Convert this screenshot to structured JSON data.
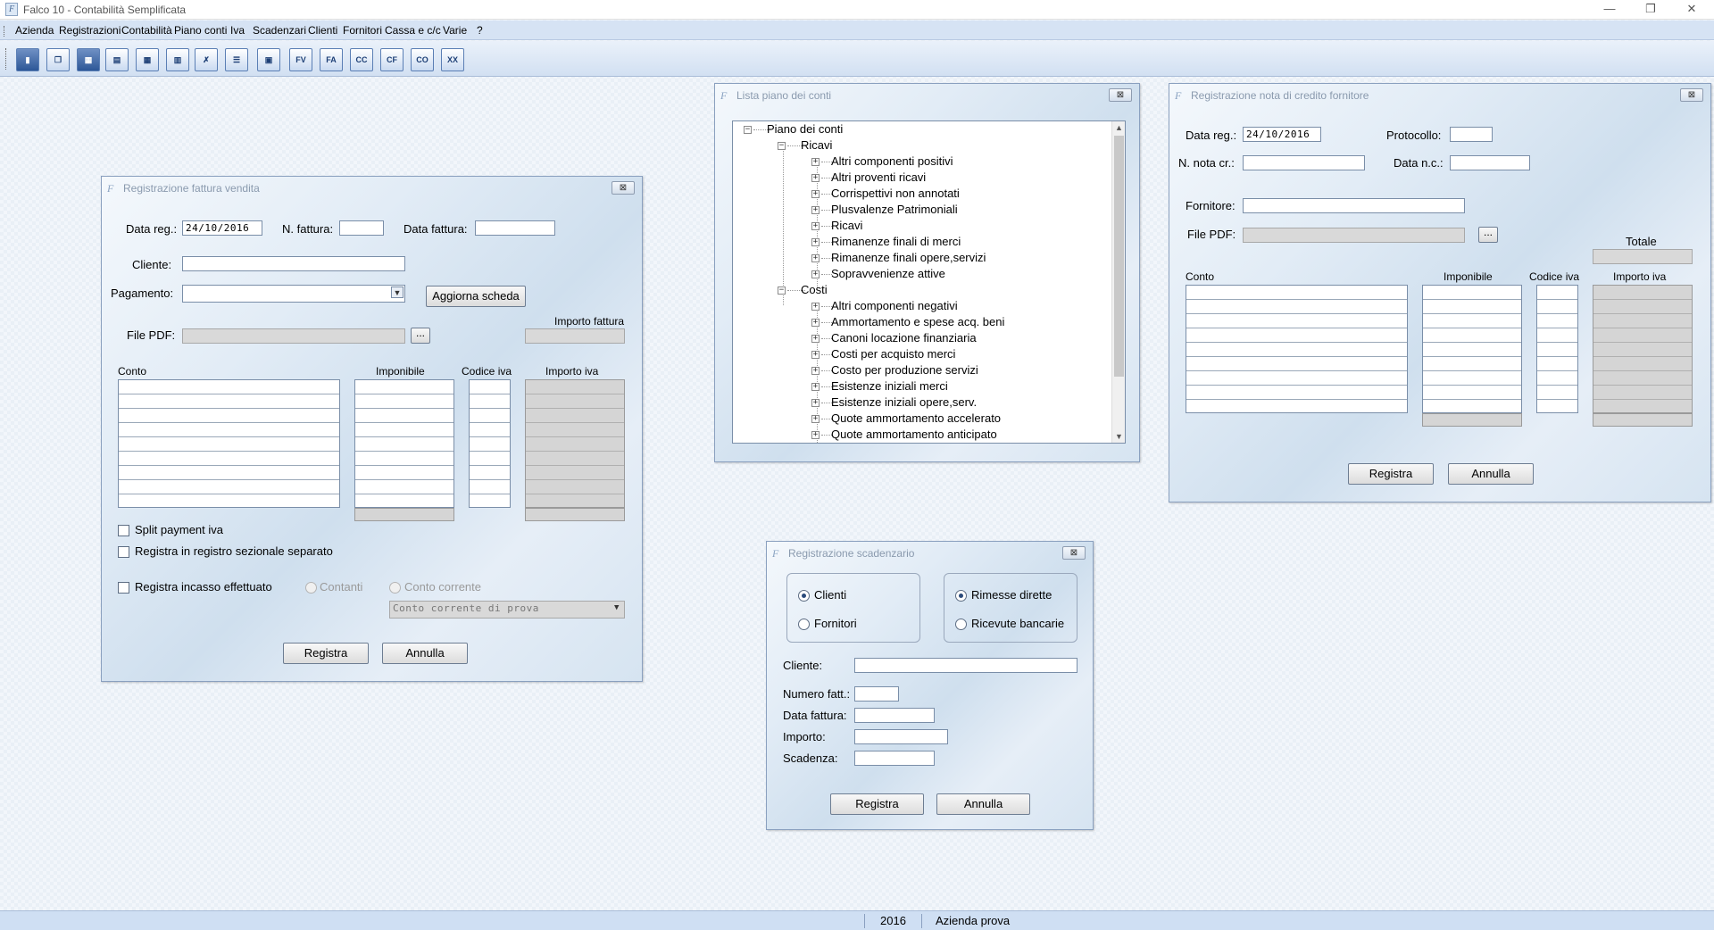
{
  "app": {
    "title": "Falco 10 - Contabilità Semplificata",
    "icon": "F"
  },
  "window_controls": {
    "minimize": "—",
    "restore": "❐",
    "close": "✕"
  },
  "menu": [
    "Azienda",
    "Registrazioni",
    "Contabilità",
    "Piano conti",
    "Iva",
    "Scadenzari",
    "Clienti",
    "Fornitori",
    "Cassa e c/c",
    "Varie",
    "?"
  ],
  "toolbar": {
    "fv": "FV",
    "fa": "FA",
    "cc": "CC",
    "cf": "CF",
    "co": "CO",
    "xx": "XX"
  },
  "fattura": {
    "title": "Registrazione fattura vendita",
    "close": "⊠",
    "data_reg_label": "Data reg.:",
    "data_reg": "24/10/2016",
    "n_fattura_label": "N. fattura:",
    "n_fattura": "",
    "data_fattura_label": "Data fattura:",
    "data_fattura": "",
    "cliente_label": "Cliente:",
    "cliente": "",
    "pagamento_label": "Pagamento:",
    "pagamento": "",
    "aggiorna_label": "Aggiorna scheda",
    "file_pdf_label": "File PDF:",
    "file_pdf": "",
    "browse_label": "...",
    "importo_fattura_label": "Importo fattura",
    "importo_fattura": "",
    "col_conto": "Conto",
    "col_imponibile": "Imponibile",
    "col_codice_iva": "Codice iva",
    "col_importo_iva": "Importo iva",
    "split_label": "Split payment iva",
    "registro_label": "Registra in registro sezionale separato",
    "incasso_label": "Registra incasso effettuato",
    "contanti_label": "Contanti",
    "conto_corrente_label": "Conto corrente",
    "conto_corrente_value": "Conto corrente di prova",
    "registra_label": "Registra",
    "annulla_label": "Annulla"
  },
  "piano": {
    "title": "Lista piano dei conti",
    "close": "⊠",
    "root": "Piano dei conti",
    "ricavi": "Ricavi",
    "ricavi_items": [
      "Altri componenti positivi",
      "Altri proventi ricavi",
      "Corrispettivi non annotati",
      "Plusvalenze Patrimoniali",
      "Ricavi",
      "Rimanenze finali di merci",
      "Rimanenze finali opere,servizi",
      "Sopravvenienze attive"
    ],
    "costi": "Costi",
    "costi_items": [
      "Altri componenti negativi",
      "Ammortamento e spese acq. beni",
      "Canoni locazione finanziaria",
      "Costi per acquisto merci",
      "Costo per produzione servizi",
      "Esistenze iniziali merci",
      "Esistenze iniziali opere,serv.",
      "Quote ammortamento accelerato",
      "Quote ammortamento anticipato"
    ],
    "expand": "+",
    "collapse": "−"
  },
  "nota": {
    "title": "Registrazione nota di credito fornitore",
    "close": "⊠",
    "data_reg_label": "Data reg.:",
    "data_reg": "24/10/2016",
    "protocollo_label": "Protocollo:",
    "protocollo": "",
    "n_nota_label": "N. nota cr.:",
    "n_nota": "",
    "data_nc_label": "Data n.c.:",
    "data_nc": "",
    "fornitore_label": "Fornitore:",
    "fornitore": "",
    "file_pdf_label": "File PDF:",
    "file_pdf": "",
    "browse_label": "...",
    "totale_label": "Totale",
    "totale": "",
    "col_conto": "Conto",
    "col_imponibile": "Imponibile",
    "col_codice_iva": "Codice iva",
    "col_importo_iva": "Importo iva",
    "registra_label": "Registra",
    "annulla_label": "Annulla"
  },
  "scadenzario": {
    "title": "Registrazione scadenzario",
    "close": "⊠",
    "clienti_label": "Clienti",
    "fornitori_label": "Fornitori",
    "rimesse_label": "Rimesse dirette",
    "ricevute_label": "Ricevute bancarie",
    "cliente_label": "Cliente:",
    "cliente": "",
    "numero_label": "Numero fatt.:",
    "numero": "",
    "data_label": "Data fattura:",
    "data": "",
    "importo_label": "Importo:",
    "importo": "",
    "scadenza_label": "Scadenza:",
    "scadenza": "",
    "registra_label": "Registra",
    "annulla_label": "Annulla"
  },
  "status": {
    "year": "2016",
    "company": "Azienda prova"
  },
  "colors": {
    "menubar": "#d6e3f4",
    "statusbar": "#cfdff3",
    "window_border": "#8aa0bf"
  }
}
